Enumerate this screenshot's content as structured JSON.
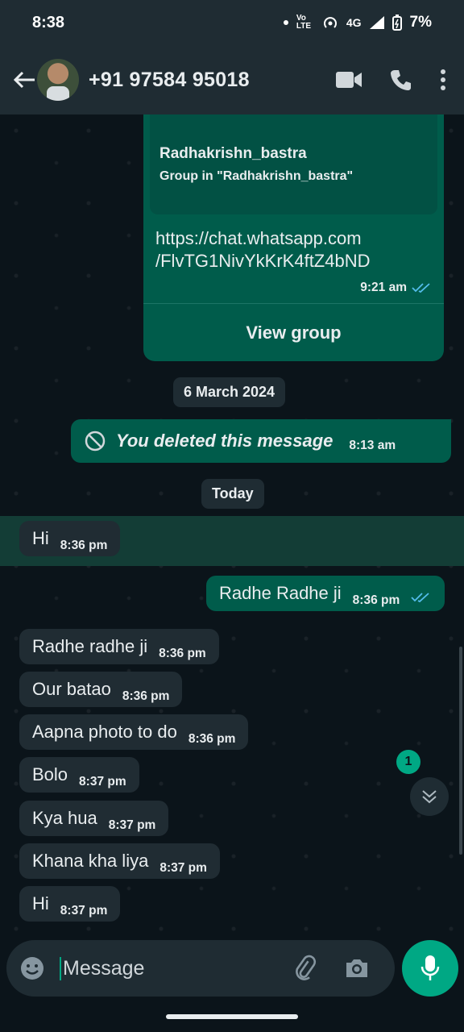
{
  "status_bar": {
    "time": "8:38",
    "network": "4G",
    "battery": "7%",
    "volte": "Vo LTE"
  },
  "header": {
    "contact": "+91 97584 95018"
  },
  "group_card": {
    "name": "Radhakrishn_bastra",
    "subtitle": "Group in \"Radhakrishn_bastra\"",
    "link_line1": "https://chat.whatsapp.com",
    "link_line2": "/FlvTG1NivYkKrK4ftZ4bND",
    "time": "9:21 am",
    "action": "View group"
  },
  "chips": {
    "date": "6 March 2024",
    "today": "Today"
  },
  "deleted": {
    "text": "You deleted this message",
    "time": "8:13 am"
  },
  "messages": [
    {
      "dir": "in",
      "text": "Hi",
      "time": "8:36 pm"
    },
    {
      "dir": "out",
      "text": "Radhe Radhe ji",
      "time": "8:36 pm"
    },
    {
      "dir": "in",
      "text": "Radhe radhe ji",
      "time": "8:36 pm"
    },
    {
      "dir": "in",
      "text": "Our batao",
      "time": "8:36 pm"
    },
    {
      "dir": "in",
      "text": "Aapna photo to do",
      "time": "8:36 pm"
    },
    {
      "dir": "in",
      "text": "Bolo",
      "time": "8:37 pm"
    },
    {
      "dir": "in",
      "text": "Kya hua",
      "time": "8:37 pm"
    },
    {
      "dir": "in",
      "text": "Khana kha liya",
      "time": "8:37 pm"
    },
    {
      "dir": "in",
      "text": "Hi",
      "time": "8:37 pm"
    }
  ],
  "unread_count": "1",
  "composer": {
    "placeholder": "Message"
  },
  "colors": {
    "accent": "#00a884",
    "outgoing": "#005c4b",
    "incoming": "#202c33",
    "background": "#0b141a",
    "tick": "#53bdeb"
  }
}
